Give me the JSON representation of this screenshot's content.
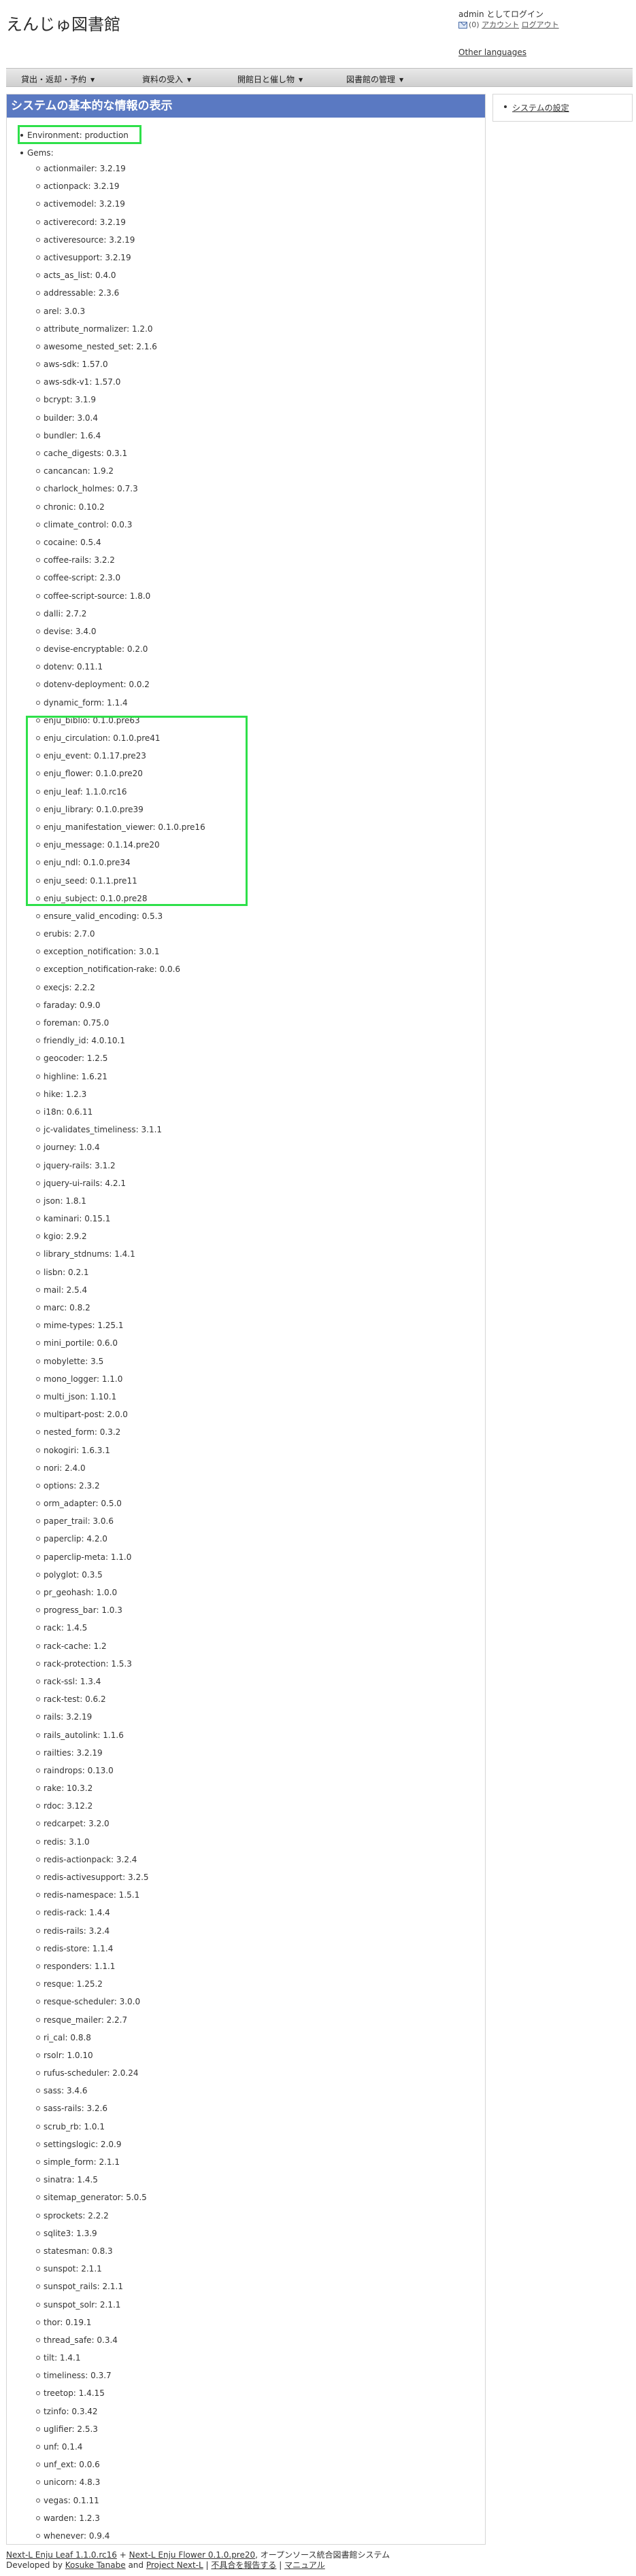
{
  "header": {
    "site_title": "えんじゅ図書館",
    "login_status": "admin としてログイン",
    "message_count": "(0)",
    "account_link": "アカウント",
    "logout_link": "ログアウト",
    "other_languages": "Other languages"
  },
  "nav": {
    "items": [
      {
        "label": "貸出・返却・予約"
      },
      {
        "label": "資料の受入"
      },
      {
        "label": "開館日と催し物"
      },
      {
        "label": "図書館の管理"
      }
    ]
  },
  "main": {
    "title": "システムの基本的な情報の表示",
    "environment": "Environment: production",
    "gems_label": "Gems:",
    "gems": [
      "actionmailer: 3.2.19",
      "actionpack: 3.2.19",
      "activemodel: 3.2.19",
      "activerecord: 3.2.19",
      "activeresource: 3.2.19",
      "activesupport: 3.2.19",
      "acts_as_list: 0.4.0",
      "addressable: 2.3.6",
      "arel: 3.0.3",
      "attribute_normalizer: 1.2.0",
      "awesome_nested_set: 2.1.6",
      "aws-sdk: 1.57.0",
      "aws-sdk-v1: 1.57.0",
      "bcrypt: 3.1.9",
      "builder: 3.0.4",
      "bundler: 1.6.4",
      "cache_digests: 0.3.1",
      "cancancan: 1.9.2",
      "charlock_holmes: 0.7.3",
      "chronic: 0.10.2",
      "climate_control: 0.0.3",
      "cocaine: 0.5.4",
      "coffee-rails: 3.2.2",
      "coffee-script: 2.3.0",
      "coffee-script-source: 1.8.0",
      "dalli: 2.7.2",
      "devise: 3.4.0",
      "devise-encryptable: 0.2.0",
      "dotenv: 0.11.1",
      "dotenv-deployment: 0.0.2",
      "dynamic_form: 1.1.4",
      "enju_biblio: 0.1.0.pre63",
      "enju_circulation: 0.1.0.pre41",
      "enju_event: 0.1.17.pre23",
      "enju_flower: 0.1.0.pre20",
      "enju_leaf: 1.1.0.rc16",
      "enju_library: 0.1.0.pre39",
      "enju_manifestation_viewer: 0.1.0.pre16",
      "enju_message: 0.1.14.pre20",
      "enju_ndl: 0.1.0.pre34",
      "enju_seed: 0.1.1.pre11",
      "enju_subject: 0.1.0.pre28",
      "ensure_valid_encoding: 0.5.3",
      "erubis: 2.7.0",
      "exception_notification: 3.0.1",
      "exception_notification-rake: 0.0.6",
      "execjs: 2.2.2",
      "faraday: 0.9.0",
      "foreman: 0.75.0",
      "friendly_id: 4.0.10.1",
      "geocoder: 1.2.5",
      "highline: 1.6.21",
      "hike: 1.2.3",
      "i18n: 0.6.11",
      "jc-validates_timeliness: 3.1.1",
      "journey: 1.0.4",
      "jquery-rails: 3.1.2",
      "jquery-ui-rails: 4.2.1",
      "json: 1.8.1",
      "kaminari: 0.15.1",
      "kgio: 2.9.2",
      "library_stdnums: 1.4.1",
      "lisbn: 0.2.1",
      "mail: 2.5.4",
      "marc: 0.8.2",
      "mime-types: 1.25.1",
      "mini_portile: 0.6.0",
      "mobylette: 3.5",
      "mono_logger: 1.1.0",
      "multi_json: 1.10.1",
      "multipart-post: 2.0.0",
      "nested_form: 0.3.2",
      "nokogiri: 1.6.3.1",
      "nori: 2.4.0",
      "options: 2.3.2",
      "orm_adapter: 0.5.0",
      "paper_trail: 3.0.6",
      "paperclip: 4.2.0",
      "paperclip-meta: 1.1.0",
      "polyglot: 0.3.5",
      "pr_geohash: 1.0.0",
      "progress_bar: 1.0.3",
      "rack: 1.4.5",
      "rack-cache: 1.2",
      "rack-protection: 1.5.3",
      "rack-ssl: 1.3.4",
      "rack-test: 0.6.2",
      "rails: 3.2.19",
      "rails_autolink: 1.1.6",
      "railties: 3.2.19",
      "raindrops: 0.13.0",
      "rake: 10.3.2",
      "rdoc: 3.12.2",
      "redcarpet: 3.2.0",
      "redis: 3.1.0",
      "redis-actionpack: 3.2.4",
      "redis-activesupport: 3.2.5",
      "redis-namespace: 1.5.1",
      "redis-rack: 1.4.4",
      "redis-rails: 3.2.4",
      "redis-store: 1.1.4",
      "responders: 1.1.1",
      "resque: 1.25.2",
      "resque-scheduler: 3.0.0",
      "resque_mailer: 2.2.7",
      "ri_cal: 0.8.8",
      "rsolr: 1.0.10",
      "rufus-scheduler: 2.0.24",
      "sass: 3.4.6",
      "sass-rails: 3.2.6",
      "scrub_rb: 1.0.1",
      "settingslogic: 2.0.9",
      "simple_form: 2.1.1",
      "sinatra: 1.4.5",
      "sitemap_generator: 5.0.5",
      "sprockets: 2.2.2",
      "sqlite3: 1.3.9",
      "statesman: 0.8.3",
      "sunspot: 2.1.1",
      "sunspot_rails: 2.1.1",
      "sunspot_solr: 2.1.1",
      "thor: 0.19.1",
      "thread_safe: 0.3.4",
      "tilt: 1.4.1",
      "timeliness: 0.3.7",
      "treetop: 1.4.15",
      "tzinfo: 0.3.42",
      "uglifier: 2.5.3",
      "unf: 0.1.4",
      "unf_ext: 0.0.6",
      "unicorn: 4.8.3",
      "vegas: 0.1.11",
      "warden: 1.2.3",
      "whenever: 0.9.4"
    ]
  },
  "sidebar": {
    "items": [
      {
        "label": "システムの設定"
      }
    ]
  },
  "footer": {
    "leaf_link": "Next-L Enju Leaf 1.1.0.rc16",
    "plus": "+",
    "flower_link": "Next-L Enju Flower 0.1.0.pre20",
    "tagline": ", オープンソース統合図書館システム",
    "developed_by": "Developed by",
    "author_link": "Kosuke Tanabe",
    "and": "and",
    "project_link": "Project Next-L",
    "sep1": "|",
    "report_link": "不具合を報告する",
    "sep2": "|",
    "manual_link": "マニュアル"
  }
}
